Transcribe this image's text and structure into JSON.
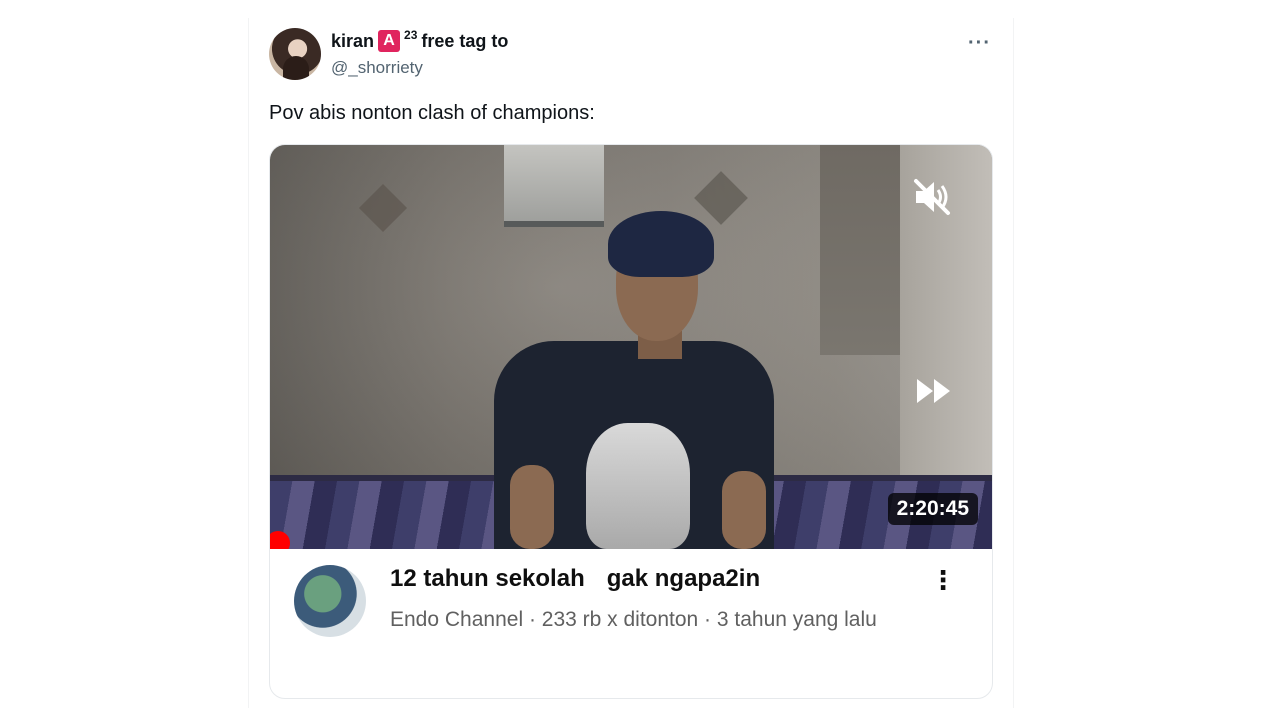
{
  "tweet": {
    "display_name": "kiran",
    "badge_letter": "A",
    "badge_sup": "23",
    "name_suffix": "free tag to",
    "handle": "@_shorriety",
    "more_label": "···",
    "text": "Pov abis nonton clash of champions:"
  },
  "embed": {
    "duration": "2:20:45",
    "title_part1": "12 tahun sekolah",
    "title_part2": "gak ngapa2in",
    "meta": "Endo Channel · 233 rb x ditonton · 3 tahun yang lalu",
    "kebab_label": "⋮",
    "icons": [
      "mute-icon",
      "fast-forward-icon",
      "more-vertical-icon"
    ]
  }
}
